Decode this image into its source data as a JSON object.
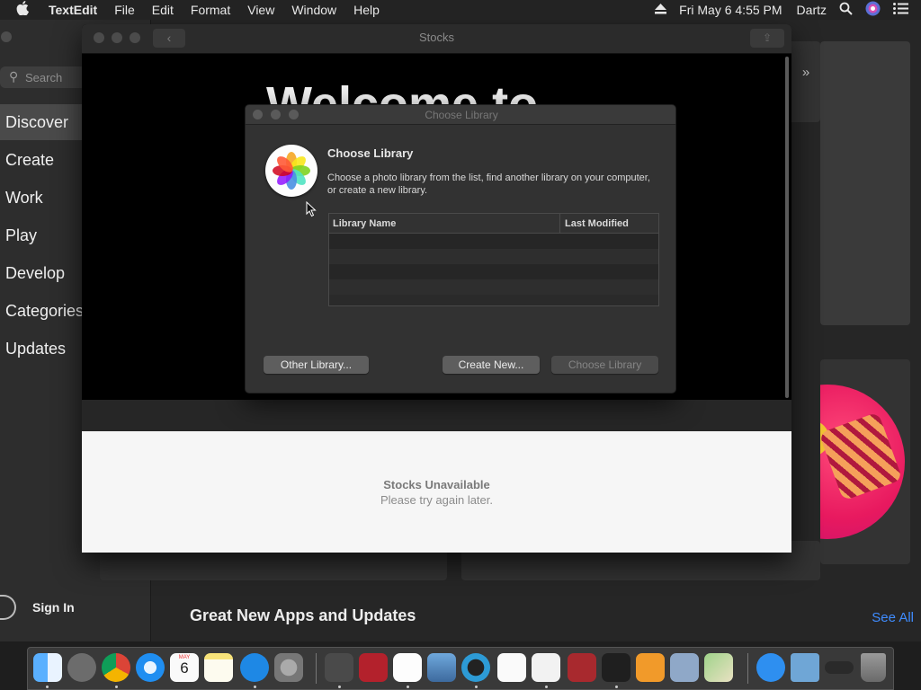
{
  "menubar": {
    "apple": "",
    "app_name": "TextEdit",
    "items": [
      "File",
      "Edit",
      "Format",
      "View",
      "Window",
      "Help"
    ],
    "datetime": "Fri May 6  4:55 PM",
    "user": "Dartz"
  },
  "appstore": {
    "search_placeholder": "Search",
    "nav": [
      "Discover",
      "Create",
      "Work",
      "Play",
      "Develop",
      "Categories",
      "Updates"
    ],
    "sign_in": "Sign In",
    "section_heading": "Great New Apps and Updates",
    "see_all": "See All"
  },
  "stocks": {
    "title": "Stocks",
    "welcome": "Welcome to",
    "unavailable": "Stocks Unavailable",
    "retry": "Please try again later."
  },
  "dialog": {
    "title": "Choose Library",
    "heading": "Choose Library",
    "description": "Choose a photo library from the list, find another library on your computer, or create a new library.",
    "col_name": "Library Name",
    "col_modified": "Last Modified",
    "btn_other": "Other Library...",
    "btn_create": "Create New...",
    "btn_choose": "Choose Library"
  },
  "dock": {
    "calendar_month": "MAY",
    "calendar_day": "6",
    "icons": [
      "finder-icon",
      "launchpad-icon",
      "chrome-icon",
      "safari-icon",
      "calendar-icon",
      "notes-icon",
      "app-store-icon",
      "system-preferences-icon",
      "folder-actions-icon",
      "photo-booth-icon",
      "photos-icon",
      "preview-icon",
      "quicktime-icon",
      "reminders-icon",
      "textedit-icon",
      "dictionary-icon",
      "activity-monitor-icon",
      "home-icon",
      "image-capture-icon",
      "maps-icon",
      "app-store-downloads-icon",
      "documents-folder-icon",
      "screenshot-icon",
      "trash-icon"
    ]
  }
}
